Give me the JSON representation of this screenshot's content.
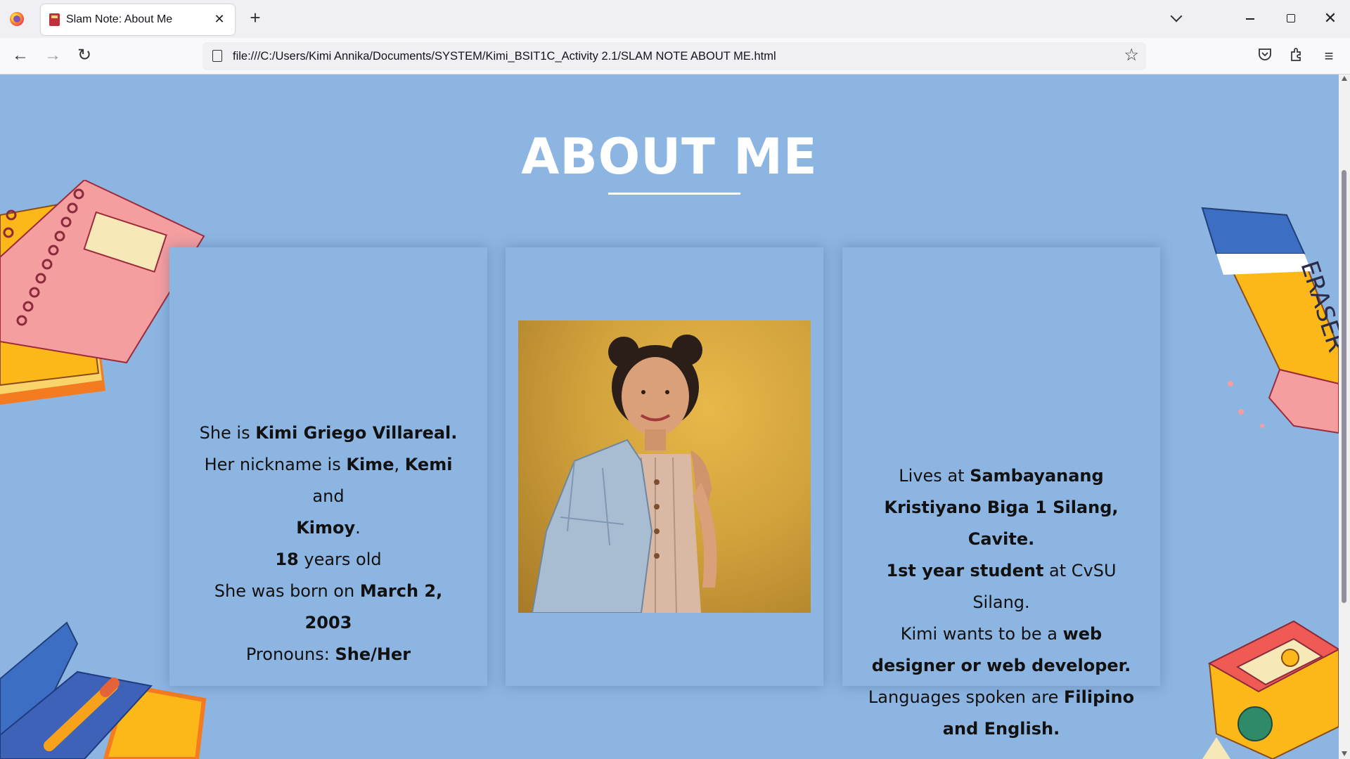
{
  "browser": {
    "tab_title": "Slam Note: About Me",
    "url": "file:///C:/Users/Kimi Annika/Documents/SYSTEM/Kimi_BSIT1C_Activity 2.1/SLAM NOTE ABOUT ME.html",
    "icons": [
      "firefox-icon",
      "favicon-icon",
      "close-icon",
      "plus-icon",
      "chevron-down-icon",
      "minimize-icon",
      "maximize-icon",
      "close-icon",
      "back-icon",
      "forward-icon",
      "reload-icon",
      "page-icon",
      "star-icon",
      "pocket-icon",
      "extensions-icon",
      "menu-icon"
    ]
  },
  "page": {
    "heading": "ABOUT ME",
    "card1": {
      "l1a": "She is ",
      "l1b": "Kimi Griego Villareal.",
      "l2a": "Her nickname is ",
      "l2b": "Kime",
      "l2c": ", ",
      "l2d": "Kemi",
      "l2e": " and ",
      "l3a": "Kimoy",
      "l3b": ".",
      "l4a": "18",
      "l4b": " years old",
      "l5a": "She was born on ",
      "l5b": "March 2, 2003",
      "l6a": "Pronouns: ",
      "l6b": "She/Her"
    },
    "card3": {
      "l1a": "Lives at ",
      "l1b": "Sambayanang Kristiyano Biga 1 Silang, Cavite.",
      "l2a": "1st year student",
      "l2b": " at CvSU Silang.",
      "l3a": "Kimi wants to be a ",
      "l3b": "web designer or web developer.",
      "l4a": "Languages spoken are ",
      "l4b": "Filipino and English."
    },
    "colors": {
      "background": "#8db5e2",
      "heading": "#ffffff"
    }
  }
}
